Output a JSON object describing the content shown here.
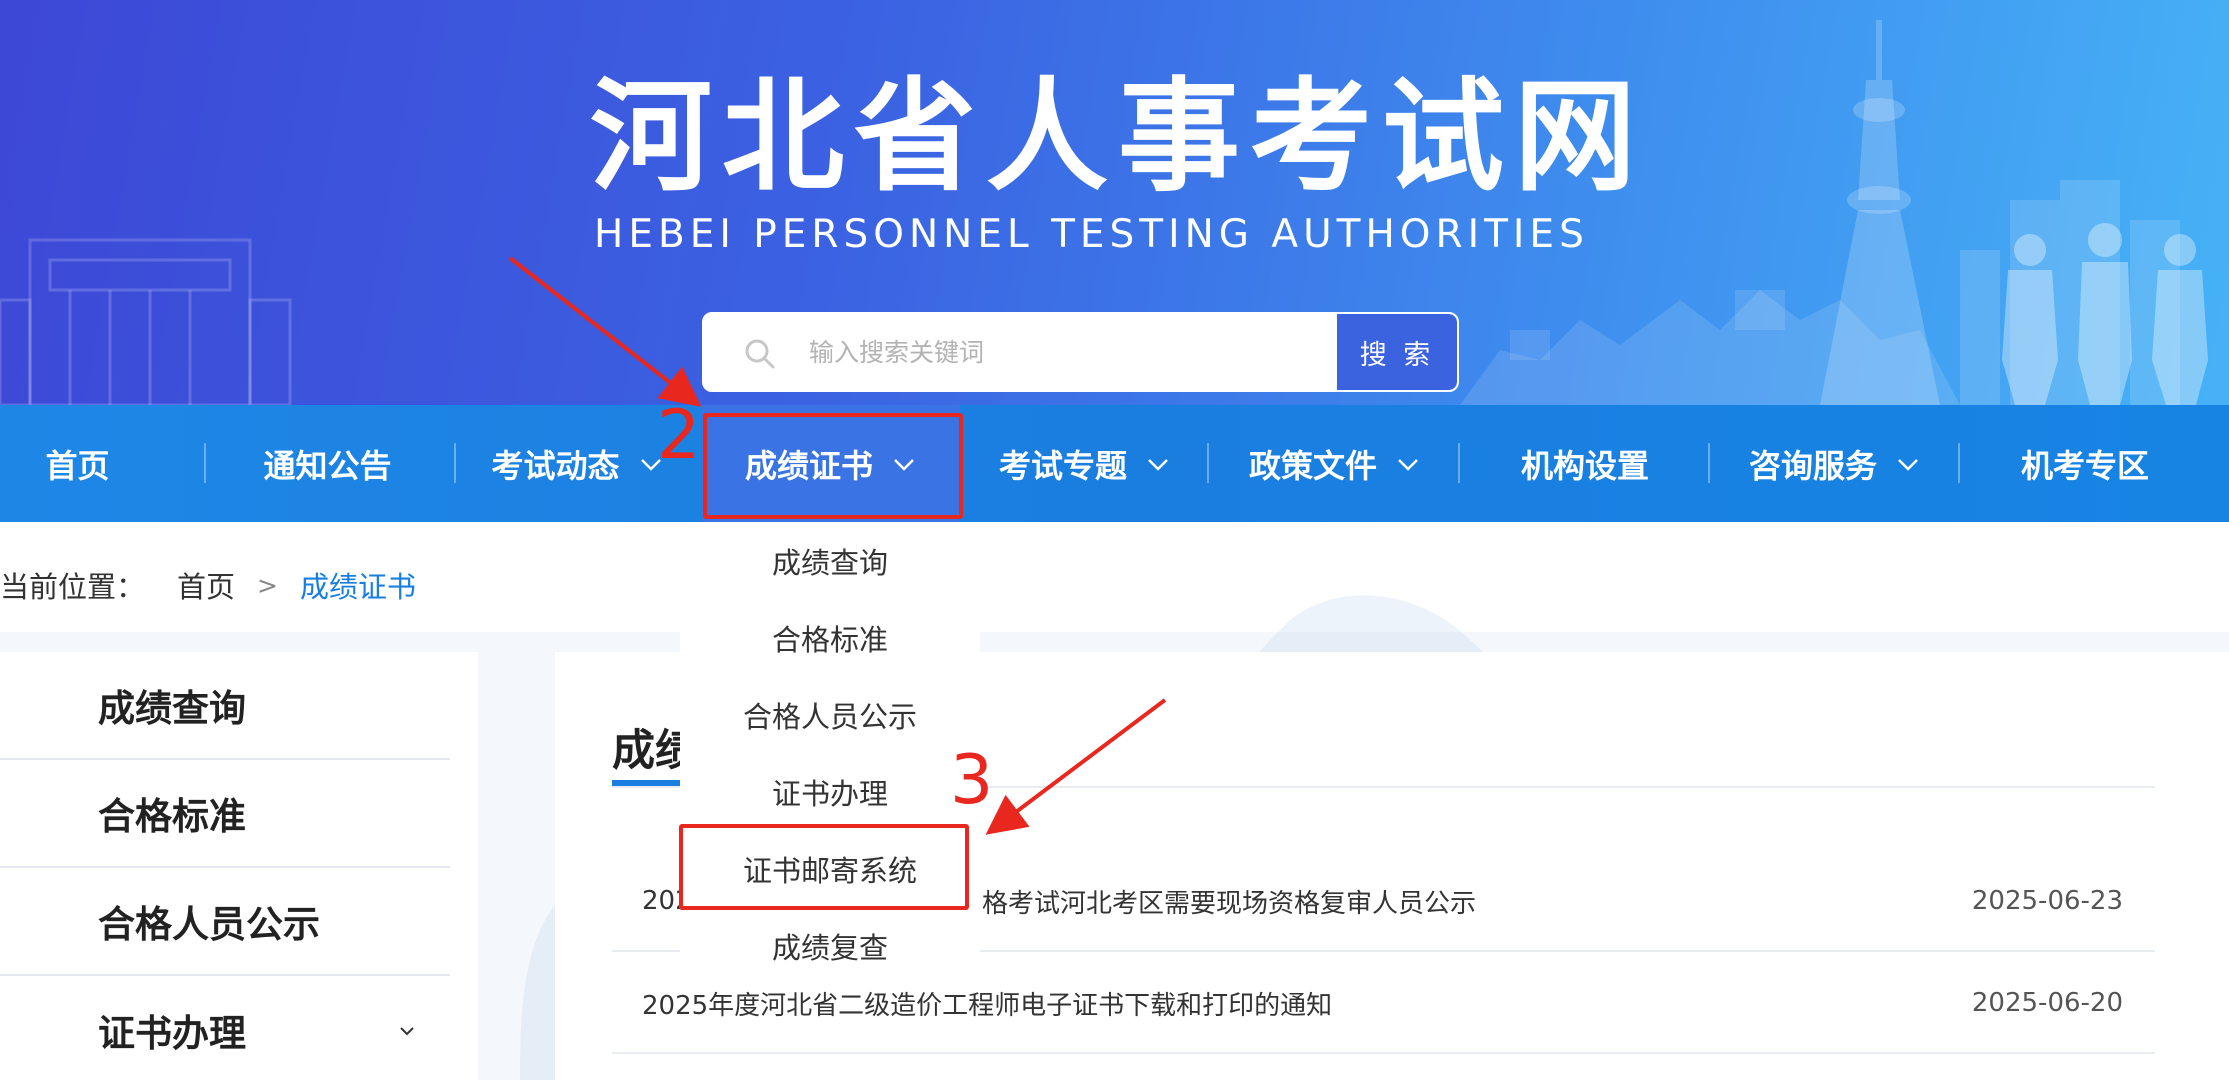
{
  "header": {
    "title": "河北省人事考试网",
    "subtitle": "HEBEI PERSONNEL TESTING AUTHORITIES"
  },
  "search": {
    "placeholder": "输入搜索关键词",
    "button_label": "搜 索"
  },
  "nav": {
    "items": [
      {
        "label": "首页",
        "has_dropdown": false
      },
      {
        "label": "通知公告",
        "has_dropdown": false
      },
      {
        "label": "考试动态",
        "has_dropdown": true
      },
      {
        "label": "成绩证书",
        "has_dropdown": true,
        "active": true
      },
      {
        "label": "考试专题",
        "has_dropdown": true
      },
      {
        "label": "政策文件",
        "has_dropdown": true
      },
      {
        "label": "机构设置",
        "has_dropdown": false
      },
      {
        "label": "咨询服务",
        "has_dropdown": true
      },
      {
        "label": "机考专区",
        "has_dropdown": false
      }
    ]
  },
  "dropdown": {
    "items": [
      "成绩查询",
      "合格标准",
      "合格人员公示",
      "证书办理",
      "证书邮寄系统",
      "成绩复查"
    ]
  },
  "breadcrumb": {
    "prefix": "当前位置：",
    "home": "首页",
    "separator": ">",
    "current": "成绩证书"
  },
  "sidebar": {
    "items": [
      {
        "label": "成绩查询",
        "has_children": false
      },
      {
        "label": "合格标准",
        "has_children": false
      },
      {
        "label": "合格人员公示",
        "has_children": false
      },
      {
        "label": "证书办理",
        "has_children": true
      }
    ]
  },
  "main": {
    "title_visible": "成绩",
    "news": [
      {
        "title_visible_left": "202",
        "title_visible_right": "格考试河北考区需要现场资格复审人员公示",
        "date": "2025-06-23"
      },
      {
        "title": "2025年度河北省二级造价工程师电子证书下载和打印的通知",
        "date": "2025-06-20"
      }
    ]
  },
  "annotations": {
    "step_2": "2",
    "step_3": "3",
    "color": "#e8281f"
  },
  "colors": {
    "nav_bg": "#1a7ee0",
    "nav_active_bg": "#3a73e4",
    "accent": "#1a7ee0",
    "search_button": "#3b63e0"
  }
}
